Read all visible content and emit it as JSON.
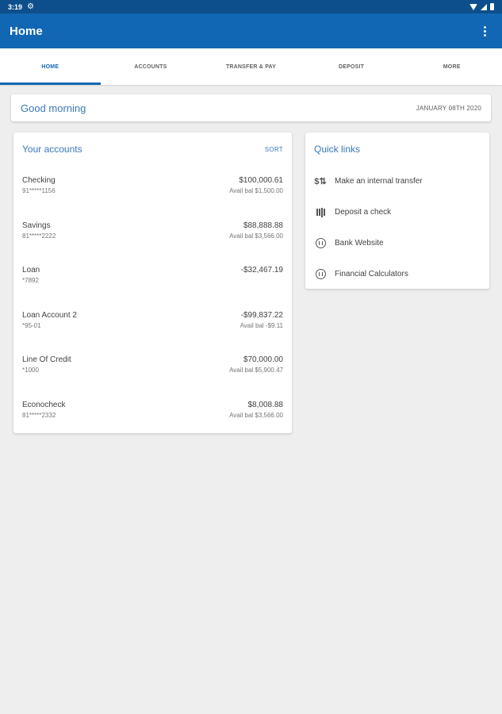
{
  "status": {
    "time": "3:19"
  },
  "appbar": {
    "title": "Home"
  },
  "tabs": [
    {
      "label": "HOME",
      "active": true
    },
    {
      "label": "ACCOUNTS",
      "active": false
    },
    {
      "label": "TRANSFER & PAY",
      "active": false
    },
    {
      "label": "DEPOSIT",
      "active": false
    },
    {
      "label": "MORE",
      "active": false
    }
  ],
  "greeting": {
    "text": "Good morning",
    "date": "JANUARY 08TH 2020"
  },
  "accounts": {
    "title": "Your accounts",
    "sort_label": "SORT",
    "items": [
      {
        "name": "Checking",
        "number": "91*****1156",
        "balance": "$100,000.61",
        "avail": "Avail bal $1,500.00"
      },
      {
        "name": "Savings",
        "number": "81*****2222",
        "balance": "$88,888.88",
        "avail": "Avail bal $3,566.00"
      },
      {
        "name": "Loan",
        "number": "*7892",
        "balance": "-$32,467.19",
        "avail": ""
      },
      {
        "name": "Loan Account 2",
        "number": "*95-01",
        "balance": "-$99,837.22",
        "avail": "Avail bal -$9.11"
      },
      {
        "name": "Line Of Credit",
        "number": "*1000",
        "balance": "$70,000.00",
        "avail": "Avail bal $5,900.47"
      },
      {
        "name": "Econocheck",
        "number": "81*****2332",
        "balance": "$8,008.88",
        "avail": "Avail bal $3,566.00"
      }
    ]
  },
  "quick_links": {
    "title": "Quick links",
    "items": [
      {
        "label": "Make an internal transfer",
        "icon": "transfer-icon"
      },
      {
        "label": "Deposit a check",
        "icon": "check-deposit-icon"
      },
      {
        "label": "Bank Website",
        "icon": "website-icon"
      },
      {
        "label": "Financial Calculators",
        "icon": "calculator-icon"
      }
    ]
  },
  "colors": {
    "primary": "#1167b3",
    "status_bar": "#0d4f8c",
    "accent_text": "#3a78b8",
    "background": "#eeeeee"
  }
}
